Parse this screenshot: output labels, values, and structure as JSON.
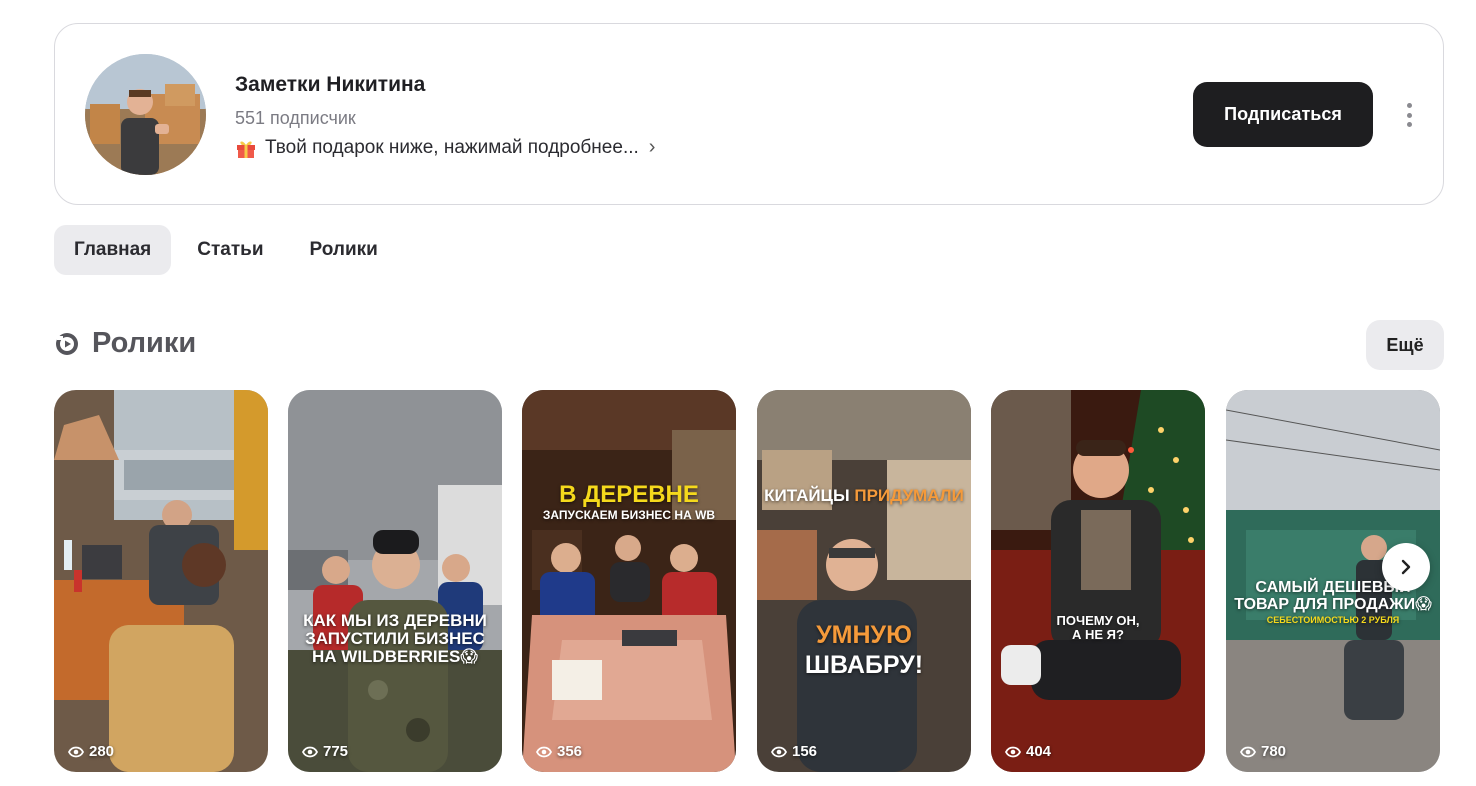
{
  "channel": {
    "title": "Заметки Никитина",
    "subscribers": "551 подписчик",
    "description": "Твой подарок ниже, нажимай подробнее...",
    "subscribe_label": "Подписаться"
  },
  "tabs": [
    {
      "label": "Главная",
      "active": true
    },
    {
      "label": "Статьи",
      "active": false
    },
    {
      "label": "Ролики",
      "active": false
    }
  ],
  "section": {
    "title": "Ролики",
    "more_label": "Ещё"
  },
  "reels": [
    {
      "views": "280",
      "overlay_lines": []
    },
    {
      "views": "775",
      "overlay_lines": [
        "КАК МЫ ИЗ ДЕРЕВНИ",
        "ЗАПУСТИЛИ БИЗНЕС",
        "НА WILDBERRIES😱"
      ]
    },
    {
      "views": "356",
      "overlay_lines": [
        "В ДЕРЕВНЕ",
        "ЗАПУСКАЕМ БИЗНЕС НА WB"
      ]
    },
    {
      "views": "156",
      "overlay_lines": [
        "КИТАЙЦЫ",
        "ПРИДУМАЛИ",
        "УМНУЮ",
        "ШВАБРУ!"
      ]
    },
    {
      "views": "404",
      "overlay_lines": [
        "ПОЧЕМУ ОН,",
        "А НЕ Я?"
      ]
    },
    {
      "views": "780",
      "overlay_lines": [
        "САМЫЙ ДЕШЕВЫЙ",
        "ТОВАР ДЛЯ ПРОДАЖИ😱",
        "СЕБЕСТОИМОСТЬЮ 2 РУБЛЯ"
      ]
    }
  ],
  "colors": {
    "accent_yellow": "#f5d91c",
    "accent_orange": "#f59a3a",
    "button_dark": "#1e1e20"
  }
}
